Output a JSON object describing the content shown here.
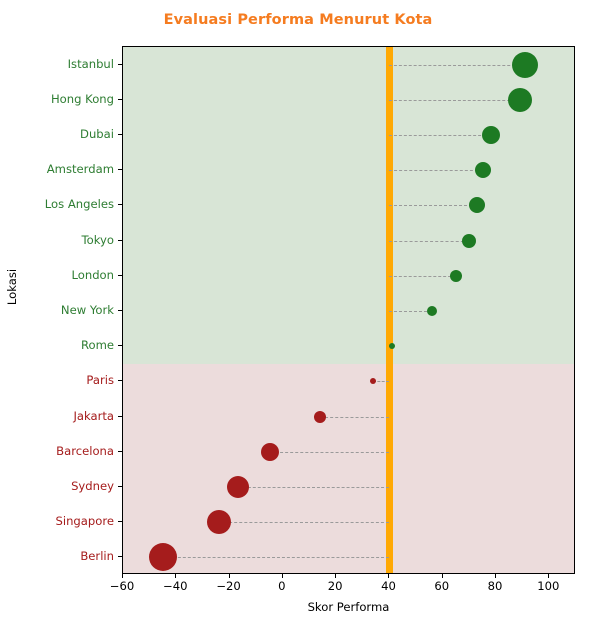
{
  "chart_data": {
    "type": "scatter",
    "title": "Evaluasi Performa Menurut Kota",
    "xlabel": "Skor Performa",
    "ylabel": "Lokasi",
    "xlim": [
      -60,
      110
    ],
    "xticks": [
      -60,
      -40,
      -20,
      0,
      20,
      40,
      60,
      80,
      100
    ],
    "xtick_labels": [
      "−60",
      "−40",
      "−20",
      "0",
      "20",
      "40",
      "60",
      "80",
      "100"
    ],
    "grid": false,
    "legend": null,
    "reference_line": {
      "value": 40,
      "color": "#ffa904",
      "orientation": "vertical"
    },
    "bands": [
      {
        "label": "above-reference",
        "color": "#d8e5d6",
        "from_category": "Istanbul",
        "to_category": "Rome"
      },
      {
        "label": "below-reference",
        "color": "#ecdcdc",
        "from_category": "Paris",
        "to_category": "Berlin"
      }
    ],
    "positive_color": "#1d7a23",
    "negative_color": "#a51c1c",
    "categories": [
      "Istanbul",
      "Hong Kong",
      "Dubai",
      "Amsterdam",
      "Los Angeles",
      "Tokyo",
      "London",
      "New York",
      "Rome",
      "Paris",
      "Jakarta",
      "Barcelona",
      "Sydney",
      "Singapore",
      "Berlin"
    ],
    "values": [
      91,
      89,
      78,
      75,
      73,
      70,
      65,
      56,
      41,
      34,
      14,
      -5,
      -17,
      -24,
      -45
    ],
    "points": [
      {
        "label": "Istanbul",
        "value": 91,
        "sign": "pos",
        "marker_size": 13
      },
      {
        "label": "Hong Kong",
        "value": 89,
        "sign": "pos",
        "marker_size": 12
      },
      {
        "label": "Dubai",
        "value": 78,
        "sign": "pos",
        "marker_size": 9
      },
      {
        "label": "Amsterdam",
        "value": 75,
        "sign": "pos",
        "marker_size": 8
      },
      {
        "label": "Los Angeles",
        "value": 73,
        "sign": "pos",
        "marker_size": 8
      },
      {
        "label": "Tokyo",
        "value": 70,
        "sign": "pos",
        "marker_size": 7
      },
      {
        "label": "London",
        "value": 65,
        "sign": "pos",
        "marker_size": 6
      },
      {
        "label": "New York",
        "value": 56,
        "sign": "pos",
        "marker_size": 5
      },
      {
        "label": "Rome",
        "value": 41,
        "sign": "pos",
        "marker_size": 3
      },
      {
        "label": "Paris",
        "value": 34,
        "sign": "neg",
        "marker_size": 3
      },
      {
        "label": "Jakarta",
        "value": 14,
        "sign": "neg",
        "marker_size": 6
      },
      {
        "label": "Barcelona",
        "value": -5,
        "sign": "neg",
        "marker_size": 9
      },
      {
        "label": "Sydney",
        "value": -17,
        "sign": "neg",
        "marker_size": 11
      },
      {
        "label": "Singapore",
        "value": -24,
        "sign": "neg",
        "marker_size": 12
      },
      {
        "label": "Berlin",
        "value": -45,
        "sign": "neg",
        "marker_size": 14
      }
    ]
  }
}
